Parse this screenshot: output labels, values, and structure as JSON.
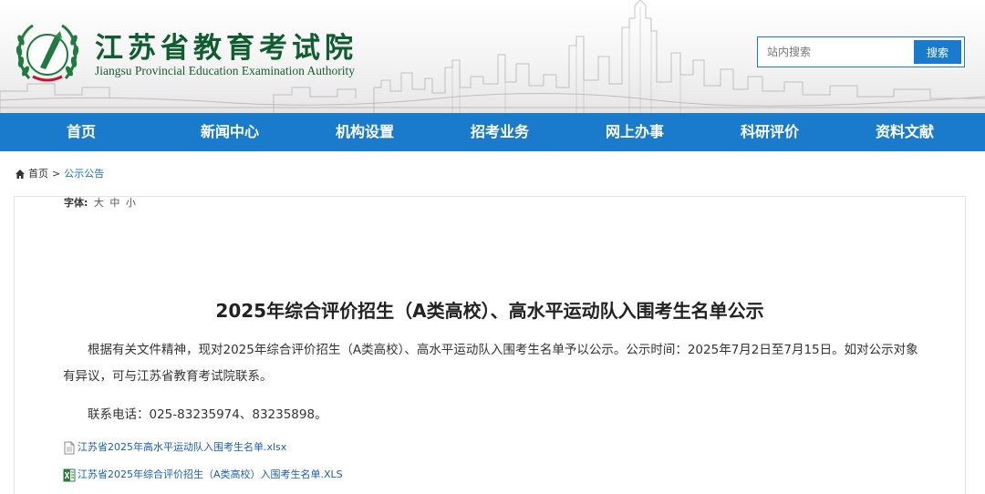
{
  "header": {
    "logo_cn": "江苏省教育考试院",
    "logo_en": "Jiangsu Provincial Education Examination Authority",
    "emblem_icon": "laurel-emblem-icon"
  },
  "search": {
    "placeholder": "站内搜索",
    "button_label": "搜索"
  },
  "nav": {
    "items": [
      {
        "label": "首页"
      },
      {
        "label": "新闻中心"
      },
      {
        "label": "机构设置"
      },
      {
        "label": "招考业务"
      },
      {
        "label": "网上办事"
      },
      {
        "label": "科研评价"
      },
      {
        "label": "资料文献"
      }
    ]
  },
  "breadcrumb": {
    "home_icon": "home-icon",
    "home": "首页",
    "separator": ">",
    "current": "公示公告"
  },
  "article": {
    "font_label": "字体:",
    "font_large": "大",
    "font_medium": "中",
    "font_small": "小",
    "title": "2025年综合评价招生（A类高校）、高水平运动队入围考生名单公示",
    "paragraph1": "根据有关文件精神，现对2025年综合评价招生（A类高校）、高水平运动队入围考生名单予以公示。公示时间：2025年7月2日至7月15日。如对公示对象有异议，可与江苏省教育考试院联系。",
    "paragraph2": "联系电话：025-83235974、83235898。",
    "attachments": [
      {
        "label": "江苏省2025年高水平运动队入围考生名单.xlsx",
        "icon": "document-icon"
      },
      {
        "label": "江苏省2025年综合评价招生（A类高校）入围考生名单.XLS",
        "icon": "excel-icon"
      }
    ]
  },
  "colors": {
    "nav_bg": "#1a7acb",
    "logo_green": "#0d5d2e",
    "link_blue": "#1a6fc4"
  }
}
